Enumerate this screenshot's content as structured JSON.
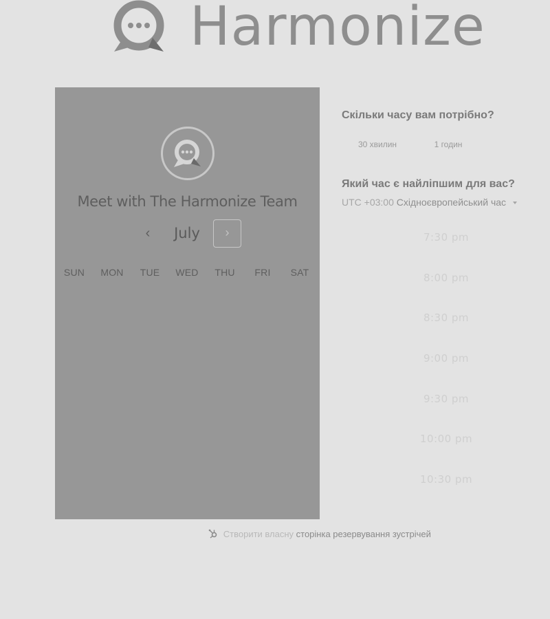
{
  "brand": {
    "name": "Harmonize",
    "logo_icon": "chat-bubble-dots-icon"
  },
  "panel": {
    "title": "Meet with The Harmonize Team",
    "avatar_icon": "chat-bubble-dots-icon",
    "month": "July",
    "prev_icon": "chevron-left-icon",
    "prev_glyph": "‹",
    "next_icon": "chevron-right-icon",
    "next_glyph": "›",
    "weekdays": [
      "SUN",
      "MON",
      "TUE",
      "WED",
      "THU",
      "FRI",
      "SAT"
    ]
  },
  "duration": {
    "title": "Скільки часу вам потрібно?",
    "options": [
      "30 хвилин",
      "1 годин"
    ]
  },
  "time": {
    "title": "Який час є найліпшим для вас?",
    "timezone_offset": "UTC +03:00",
    "timezone_name": "Східноєвропейський час",
    "slots": [
      "7:30 pm",
      "8:00 pm",
      "8:30 pm",
      "9:00 pm",
      "9:30 pm",
      "10:00 pm",
      "10:30 pm"
    ]
  },
  "footer": {
    "icon": "hubspot-sprocket-icon",
    "prefix": "Створити власну",
    "link": "сторінка резервування зустрічей"
  },
  "colors": {
    "page_background": "#e3e3e3",
    "panel_background": "#979797",
    "brand_text": "#8e8e8e"
  }
}
